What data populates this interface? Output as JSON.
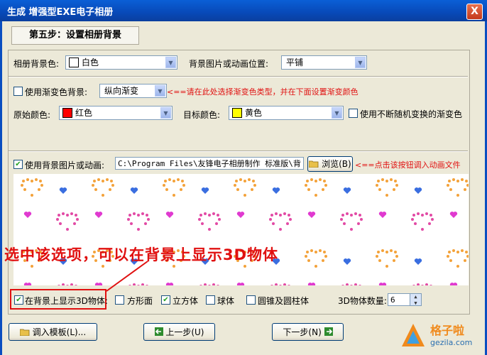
{
  "window": {
    "title": "生成  增强型EXE电子相册",
    "close_symbol": "X"
  },
  "step_label": "第五步：设置相册背景",
  "bg_color": {
    "label": "相册背景色:",
    "value": "白色",
    "swatch": "#ffffff"
  },
  "position": {
    "label": "背景图片或动画位置:",
    "value": "平铺"
  },
  "gradient": {
    "checkbox_label": "使用渐变色背景:",
    "type_value": "纵向渐变",
    "hint": "<==请在此处选择渐变色类型，并在下面设置渐变颜色",
    "src_label": "原始颜色:",
    "src_value": "红色",
    "src_swatch": "#ff0000",
    "dst_label": "目标颜色:",
    "dst_value": "黄色",
    "dst_swatch": "#ffff00",
    "random_label": "使用不断随机变换的渐变色"
  },
  "bgimage": {
    "checkbox_label": "使用背景图片或动画:",
    "path": "C:\\Program Files\\友锋电子相册制作 标准版\\背",
    "browse_label": "浏览(B)",
    "hint": "<==点击该按钮调入动画文件"
  },
  "callout": "选中该选项，可以在背景上显示3D物体",
  "objects": {
    "show3d_label": "在背景上显示3D物体:",
    "cube_square_label": "方形面",
    "cube_label": "立方体",
    "sphere_label": "球体",
    "cone_label": "圆锥及圆柱体",
    "count_label": "3D物体数量:",
    "count_value": "6"
  },
  "buttons": {
    "load_template": "调入模板(L)...",
    "prev": "上一步(U)",
    "next": "下一步(N)"
  },
  "watermark": {
    "brand": "格子啦",
    "url": "gezila.com"
  },
  "colors": {
    "accent": "#0a4ec0",
    "highlight": "#e01010"
  }
}
